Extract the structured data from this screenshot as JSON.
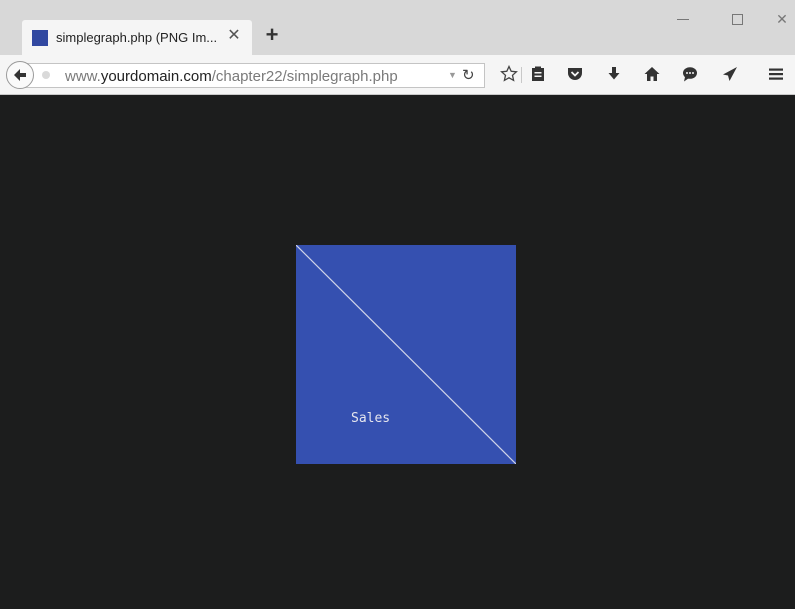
{
  "browser": {
    "tab": {
      "title": "simplegraph.php (PNG Im...",
      "close": "✕",
      "favicon_color": "#3148a0"
    },
    "new_tab": "+",
    "window_controls": {
      "close": "✕"
    },
    "navbar": {
      "url_scheme_host": "www.",
      "url_domain": "yourdomain.com",
      "url_path": "/chapter22/simplegraph.php",
      "toolbar_icons": [
        "bookmark-star-icon",
        "reading-list-icon",
        "pocket-icon",
        "download-icon",
        "home-icon",
        "chat-icon",
        "send-icon",
        "menu-icon"
      ]
    }
  },
  "content": {
    "background_color": "#1c1d1d",
    "image": {
      "fill_color": "#3550b0",
      "line_color": "#d0d4e8",
      "label": "Sales"
    }
  }
}
